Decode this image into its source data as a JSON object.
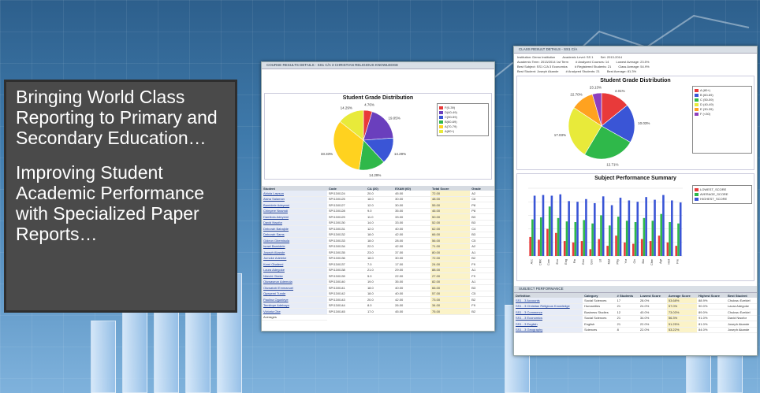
{
  "promo": {
    "line1": "Bringing World Class Reporting to Primary and Secondary Education…",
    "line2": "Improving Student Academic Performance with Specialized Paper Reports…"
  },
  "report_left": {
    "header": "COURSE RESULTS DETAILS - SS1 C/A 3 CHRISTIAN RELIGIOUS KNOWLEDGE",
    "chart_title": "Student Grade Distribution",
    "pie_labels": [
      "4.76%",
      "19.05%",
      "14.29%",
      "14.29%",
      "33.33%",
      "14.29%"
    ],
    "legend": [
      "F(0-39)",
      "D(40-49)",
      "C(50-59)",
      "B(60-69)",
      "A(70-79)",
      "A(80+)"
    ],
    "table_headers": [
      "Student",
      "Code",
      "CA (20)",
      "EXAM (60)",
      "Total Score",
      "Grade"
    ],
    "rows": [
      [
        "Abiola Lawson",
        "SP/13/0124",
        "20.0",
        "45.00",
        "72.00",
        "A2"
      ],
      [
        "Aisha Salaman",
        "SP/13/0125",
        "18.0",
        "30.00",
        "48.00",
        "C6"
      ],
      [
        "Bamidele Adeyemi",
        "SP/13/0127",
        "12.0",
        "30.00",
        "55.00",
        "P8"
      ],
      [
        "Chinyere Nnamdi",
        "SP/13/0128",
        "9.0",
        "35.00",
        "46.00",
        "P8"
      ],
      [
        "Damilola Adeyemi",
        "SP/13/0129",
        "11.0",
        "33.00",
        "50.00",
        "B3"
      ],
      [
        "David Nwofor",
        "SP/13/0130",
        "14.0",
        "33.00",
        "52.00",
        "B3"
      ],
      [
        "Deborah Babajide",
        "SP/13/0131",
        "12.0",
        "40.00",
        "62.00",
        "C4"
      ],
      [
        "Deborah Sams",
        "SP/13/0132",
        "18.0",
        "42.00",
        "66.00",
        "B3"
      ],
      [
        "Gideon Gbemisola",
        "SP/13/0133",
        "18.0",
        "28.00",
        "56.00",
        "C5"
      ],
      [
        "Israel Bamidele",
        "SP/13/0134",
        "22.0",
        "42.00",
        "71.00",
        "A2"
      ],
      [
        "Joseph Akande",
        "SP/13/0135",
        "23.0",
        "37.00",
        "80.00",
        "A1"
      ],
      [
        "Jumoke Adeleke",
        "SP/13/0136",
        "18.0",
        "30.00",
        "72.00",
        "B2"
      ],
      [
        "Kemi Obafemi",
        "SP/13/0137",
        "7.0",
        "17.00",
        "24.00",
        "F9"
      ],
      [
        "Laura Adegoke",
        "SP/13/0138",
        "21.0",
        "29.00",
        "88.00",
        "A1"
      ],
      [
        "Nkechi Okeke",
        "SP/13/0139",
        "5.0",
        "22.00",
        "27.00",
        "F9"
      ],
      [
        "Oluwaseun Ademola",
        "SP/13/0140",
        "19.0",
        "35.00",
        "82.00",
        "A1"
      ],
      [
        "Oluwatobi Emmanuel",
        "SP/13/0141",
        "18.0",
        "40.00",
        "66.00",
        "B3"
      ],
      [
        "Opeyemi Tunde",
        "SP/13/0142",
        "18.0",
        "40.00",
        "57.00",
        "C5"
      ],
      [
        "Paulina Ogunleye",
        "SP/13/0143",
        "20.0",
        "42.00",
        "73.00",
        "B2"
      ],
      [
        "Temitope Adebayo",
        "SP/13/0144",
        "8.0",
        "26.00",
        "34.00",
        "F9"
      ],
      [
        "Victoria Oke",
        "SP/13/0145",
        "17.0",
        "45.00",
        "75.00",
        "B2"
      ]
    ],
    "averages_label": "Averages"
  },
  "report_right": {
    "header": "CLASS RESULT DETAILS - SS1 C/A",
    "meta": {
      "institution": "Institution: Demo Institution",
      "academic_level": "Academic Level: SS 1",
      "set": "Set: 2013-2014",
      "academic_term": "Academic Term: 2013/2014 1st Term",
      "analyzed_courses": "# Analyzed Courses: 14",
      "lowest_average": "Lowest Average: 23.5%",
      "best_subject": "Best Subject: SS1 C/A 3 Economics",
      "registered": "# Registered Students: 21",
      "class_average": "Class Average: 54.9%",
      "best_student": "Best Student: Joseph Akande",
      "analyzed_students": "# Analyzed Students: 21",
      "best_average": "Best Average: 81.3%"
    },
    "chart1_title": "Student Grade Distribution",
    "pie_labels": [
      "4.01%",
      "10.03%",
      "12.71%",
      "17.03%",
      "22.70%",
      "23.13%"
    ],
    "legend": [
      "A (80+)",
      "B (60-69)",
      "C (50-59)",
      "D (40-49)",
      "E (30-39)",
      "F (<30)"
    ],
    "chart2_title": "Subject Performance Summary",
    "chart2_legend": [
      "LOWEST_SCORE",
      "AVERAGE_SCORE",
      "HIGHEST_SCORE"
    ],
    "subjects_header": "SUBJECT PERFORMANCE",
    "subject_headers": [
      "Definition",
      "Category",
      "# Students",
      "Lowest Score",
      "Average Score",
      "Highest Score",
      "Best Student"
    ],
    "subjects": [
      [
        "SS1 - 3 Accounts",
        "Social Sciences",
        "17",
        "28.0%",
        "53.68%",
        "88.9%",
        "Chukwu Ezekiel"
      ],
      [
        "SS1 - 3 Christian Religious Knowledge",
        "Humanities",
        "21",
        "24.0%",
        "57.0%",
        "90.0%",
        "Laura Adegoke"
      ],
      [
        "SS1 - 3 Commerce",
        "Business Studies",
        "12",
        "40.0%",
        "73.03%",
        "89.0%",
        "Chukwu Ezekiel"
      ],
      [
        "SS1 - 3 Economics",
        "Social Sciences",
        "21",
        "34.0%",
        "56.3%",
        "91.0%",
        "David Nwofor"
      ],
      [
        "SS1 - 3 English",
        "English",
        "21",
        "22.0%",
        "51.25%",
        "81.0%",
        "Joseph Akande"
      ],
      [
        "SS1 - 3 Geography",
        "Sciences",
        "8",
        "22.0%",
        "53.22%",
        "84.0%",
        "Joseph Akande"
      ]
    ]
  },
  "chart_data": [
    {
      "type": "pie",
      "title": "Student Grade Distribution",
      "labels": [
        "F(0-39)",
        "D(40-49)",
        "C(50-59)",
        "B(60-69)",
        "A(70-79)",
        "A(80+)"
      ],
      "values": [
        4.76,
        19.05,
        14.29,
        14.29,
        33.33,
        14.29
      ],
      "colors": [
        "#e83a3a",
        "#6a3fbd",
        "#3a55d6",
        "#2fb84a",
        "#ffd21f",
        "#e8ea3a"
      ]
    },
    {
      "type": "pie",
      "title": "Student Grade Distribution",
      "labels": [
        "A (80+)",
        "B (60-69)",
        "C (50-59)",
        "D (40-49)",
        "E (30-39)",
        "F (<30)"
      ],
      "values": [
        12.71,
        17.03,
        22.7,
        23.13,
        10.03,
        4.01
      ],
      "colors": [
        "#e83a3a",
        "#3a55d6",
        "#2fb84a",
        "#e8ea3a",
        "#ffa21f",
        "#8e3fbd"
      ]
    },
    {
      "type": "bar",
      "title": "Subject Performance Summary",
      "categories": [
        "Acc",
        "CRK",
        "Com",
        "Eco",
        "Eng",
        "Fin",
        "Geo",
        "Gov",
        "Lit",
        "Mat",
        "Phy",
        "Yor",
        "Civ",
        "Bio",
        "Chm",
        "Agr",
        "Hist",
        "Fre"
      ],
      "series": [
        {
          "name": "LOWEST_SCORE",
          "color": "#e83a3a",
          "values": [
            28,
            24,
            40,
            34,
            22,
            20,
            22,
            10,
            25,
            15,
            30,
            20,
            18,
            25,
            22,
            30,
            20,
            15
          ]
        },
        {
          "name": "AVERAGE_SCORE",
          "color": "#2fb84a",
          "values": [
            54,
            57,
            73,
            56,
            51,
            50,
            53,
            48,
            60,
            45,
            58,
            52,
            50,
            56,
            52,
            62,
            50,
            48
          ]
        },
        {
          "name": "HIGHEST_SCORE",
          "color": "#3a55d6",
          "values": [
            89,
            90,
            89,
            91,
            81,
            80,
            84,
            78,
            88,
            75,
            86,
            82,
            80,
            87,
            83,
            90,
            82,
            79
          ]
        }
      ],
      "ylim": [
        0,
        100
      ]
    }
  ]
}
